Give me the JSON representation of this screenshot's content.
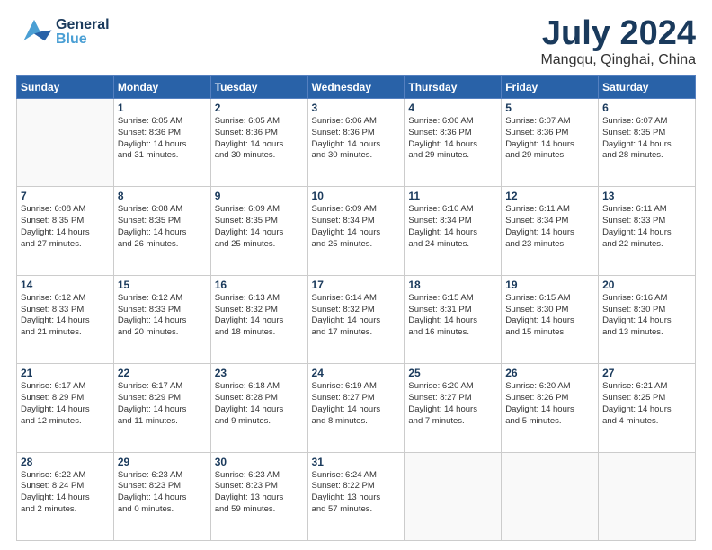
{
  "header": {
    "logo_general": "General",
    "logo_blue": "Blue",
    "month": "July 2024",
    "location": "Mangqu, Qinghai, China"
  },
  "days_of_week": [
    "Sunday",
    "Monday",
    "Tuesday",
    "Wednesday",
    "Thursday",
    "Friday",
    "Saturday"
  ],
  "weeks": [
    [
      {
        "day": "",
        "info": ""
      },
      {
        "day": "1",
        "info": "Sunrise: 6:05 AM\nSunset: 8:36 PM\nDaylight: 14 hours\nand 31 minutes."
      },
      {
        "day": "2",
        "info": "Sunrise: 6:05 AM\nSunset: 8:36 PM\nDaylight: 14 hours\nand 30 minutes."
      },
      {
        "day": "3",
        "info": "Sunrise: 6:06 AM\nSunset: 8:36 PM\nDaylight: 14 hours\nand 30 minutes."
      },
      {
        "day": "4",
        "info": "Sunrise: 6:06 AM\nSunset: 8:36 PM\nDaylight: 14 hours\nand 29 minutes."
      },
      {
        "day": "5",
        "info": "Sunrise: 6:07 AM\nSunset: 8:36 PM\nDaylight: 14 hours\nand 29 minutes."
      },
      {
        "day": "6",
        "info": "Sunrise: 6:07 AM\nSunset: 8:35 PM\nDaylight: 14 hours\nand 28 minutes."
      }
    ],
    [
      {
        "day": "7",
        "info": "Sunrise: 6:08 AM\nSunset: 8:35 PM\nDaylight: 14 hours\nand 27 minutes."
      },
      {
        "day": "8",
        "info": "Sunrise: 6:08 AM\nSunset: 8:35 PM\nDaylight: 14 hours\nand 26 minutes."
      },
      {
        "day": "9",
        "info": "Sunrise: 6:09 AM\nSunset: 8:35 PM\nDaylight: 14 hours\nand 25 minutes."
      },
      {
        "day": "10",
        "info": "Sunrise: 6:09 AM\nSunset: 8:34 PM\nDaylight: 14 hours\nand 25 minutes."
      },
      {
        "day": "11",
        "info": "Sunrise: 6:10 AM\nSunset: 8:34 PM\nDaylight: 14 hours\nand 24 minutes."
      },
      {
        "day": "12",
        "info": "Sunrise: 6:11 AM\nSunset: 8:34 PM\nDaylight: 14 hours\nand 23 minutes."
      },
      {
        "day": "13",
        "info": "Sunrise: 6:11 AM\nSunset: 8:33 PM\nDaylight: 14 hours\nand 22 minutes."
      }
    ],
    [
      {
        "day": "14",
        "info": "Sunrise: 6:12 AM\nSunset: 8:33 PM\nDaylight: 14 hours\nand 21 minutes."
      },
      {
        "day": "15",
        "info": "Sunrise: 6:12 AM\nSunset: 8:33 PM\nDaylight: 14 hours\nand 20 minutes."
      },
      {
        "day": "16",
        "info": "Sunrise: 6:13 AM\nSunset: 8:32 PM\nDaylight: 14 hours\nand 18 minutes."
      },
      {
        "day": "17",
        "info": "Sunrise: 6:14 AM\nSunset: 8:32 PM\nDaylight: 14 hours\nand 17 minutes."
      },
      {
        "day": "18",
        "info": "Sunrise: 6:15 AM\nSunset: 8:31 PM\nDaylight: 14 hours\nand 16 minutes."
      },
      {
        "day": "19",
        "info": "Sunrise: 6:15 AM\nSunset: 8:30 PM\nDaylight: 14 hours\nand 15 minutes."
      },
      {
        "day": "20",
        "info": "Sunrise: 6:16 AM\nSunset: 8:30 PM\nDaylight: 14 hours\nand 13 minutes."
      }
    ],
    [
      {
        "day": "21",
        "info": "Sunrise: 6:17 AM\nSunset: 8:29 PM\nDaylight: 14 hours\nand 12 minutes."
      },
      {
        "day": "22",
        "info": "Sunrise: 6:17 AM\nSunset: 8:29 PM\nDaylight: 14 hours\nand 11 minutes."
      },
      {
        "day": "23",
        "info": "Sunrise: 6:18 AM\nSunset: 8:28 PM\nDaylight: 14 hours\nand 9 minutes."
      },
      {
        "day": "24",
        "info": "Sunrise: 6:19 AM\nSunset: 8:27 PM\nDaylight: 14 hours\nand 8 minutes."
      },
      {
        "day": "25",
        "info": "Sunrise: 6:20 AM\nSunset: 8:27 PM\nDaylight: 14 hours\nand 7 minutes."
      },
      {
        "day": "26",
        "info": "Sunrise: 6:20 AM\nSunset: 8:26 PM\nDaylight: 14 hours\nand 5 minutes."
      },
      {
        "day": "27",
        "info": "Sunrise: 6:21 AM\nSunset: 8:25 PM\nDaylight: 14 hours\nand 4 minutes."
      }
    ],
    [
      {
        "day": "28",
        "info": "Sunrise: 6:22 AM\nSunset: 8:24 PM\nDaylight: 14 hours\nand 2 minutes."
      },
      {
        "day": "29",
        "info": "Sunrise: 6:23 AM\nSunset: 8:23 PM\nDaylight: 14 hours\nand 0 minutes."
      },
      {
        "day": "30",
        "info": "Sunrise: 6:23 AM\nSunset: 8:23 PM\nDaylight: 13 hours\nand 59 minutes."
      },
      {
        "day": "31",
        "info": "Sunrise: 6:24 AM\nSunset: 8:22 PM\nDaylight: 13 hours\nand 57 minutes."
      },
      {
        "day": "",
        "info": ""
      },
      {
        "day": "",
        "info": ""
      },
      {
        "day": "",
        "info": ""
      }
    ]
  ]
}
